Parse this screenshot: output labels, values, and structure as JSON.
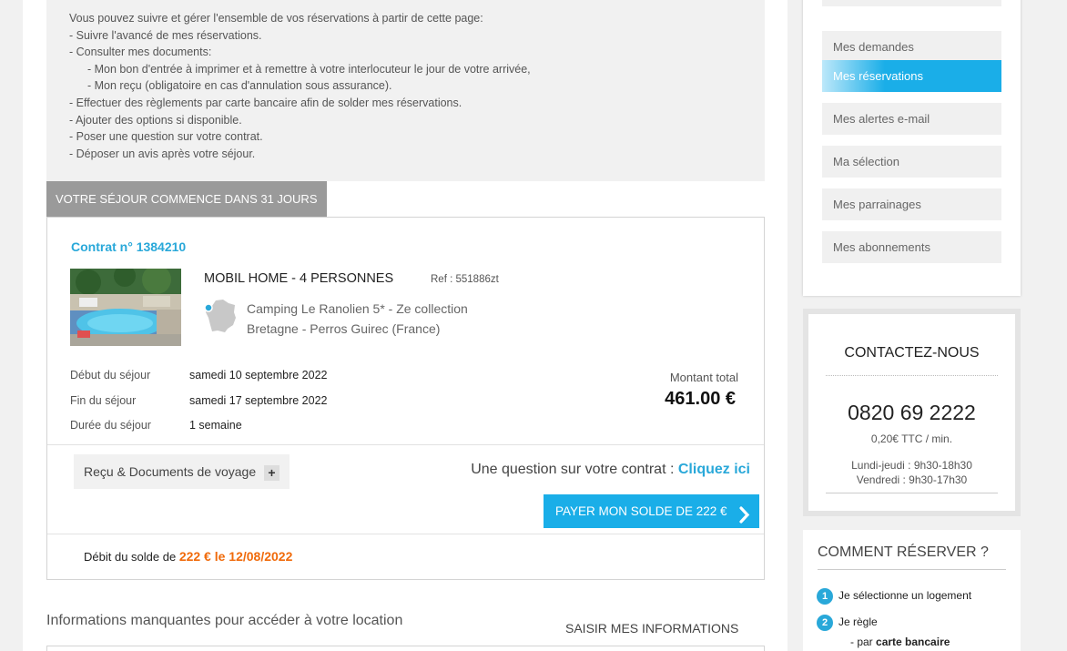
{
  "intro": {
    "lines": [
      "Vous pouvez suivre et gérer l'ensemble de vos réservations à partir de cette page:",
      "- Suivre l'avancé de mes réservations.",
      "- Consulter mes documents:",
      "- Mon bon d'entrée à imprimer et à remettre à votre interlocuteur le jour de votre arrivée,",
      "- Mon reçu (obligatoire en cas d'annulation sous assurance).",
      "- Effectuer des règlements par carte bancaire afin de solder mes réservations.",
      "- Ajouter des options si disponible.",
      "- Poser une question sur votre contrat.",
      "- Déposer un avis après votre séjour."
    ]
  },
  "stay_tag": "VOTRE SÉJOUR COMMENCE DANS 31 JOURS",
  "contract": {
    "title": "Contrat n° 1384210",
    "product_name": "MOBIL HOME - 4 PERSONNES",
    "product_ref": "Ref : 551886zt",
    "camping": "Camping Le Ranolien 5* - Ze collection",
    "location": "Bretagne - Perros Guirec (France)",
    "start_label": "Début du séjour",
    "start_value": "samedi 10 septembre 2022",
    "end_label": "Fin du séjour",
    "end_value": "samedi 17 septembre 2022",
    "duration_label": "Durée du séjour",
    "duration_value": "1 semaine",
    "total_label": "Montant total",
    "total_value": "461.00 €",
    "docs_button": "Reçu & Documents de voyage",
    "question_text": "Une question sur votre contrat :",
    "question_link": "Cliquez ici",
    "pay_button": "PAYER MON SOLDE DE 222 €",
    "debit_text": "Débit du solde de",
    "debit_amount": "222 € le 12/08/2022"
  },
  "missing_info": {
    "title": "Informations manquantes pour accéder à votre location",
    "link": "SAISIR MES INFORMATIONS"
  },
  "sidebar": {
    "items": [
      {
        "label": "Mes demandes",
        "active": false
      },
      {
        "label": "Mes réservations",
        "active": true
      },
      {
        "label": "Mes alertes e-mail",
        "active": false
      },
      {
        "label": "Ma sélection",
        "active": false
      },
      {
        "label": "Mes parrainages",
        "active": false
      },
      {
        "label": "Mes abonnements",
        "active": false
      }
    ],
    "accent_color": "#1aaee8"
  },
  "contact": {
    "title": "CONTACTEZ-NOUS",
    "phone": "0820 69 2222",
    "price": "0,20€ TTC / min.",
    "hours_weekdays": "Lundi-jeudi : 9h30-18h30",
    "hours_friday": "Vendredi : 9h30-17h30"
  },
  "howto": {
    "title": "COMMENT RÉSERVER ?",
    "step1_num": "1",
    "step1": "Je sélectionne un logement",
    "step2_num": "2",
    "step2": "Je règle",
    "step2_sub_prefix": "- par",
    "step2_sub_bold": "carte bancaire"
  }
}
